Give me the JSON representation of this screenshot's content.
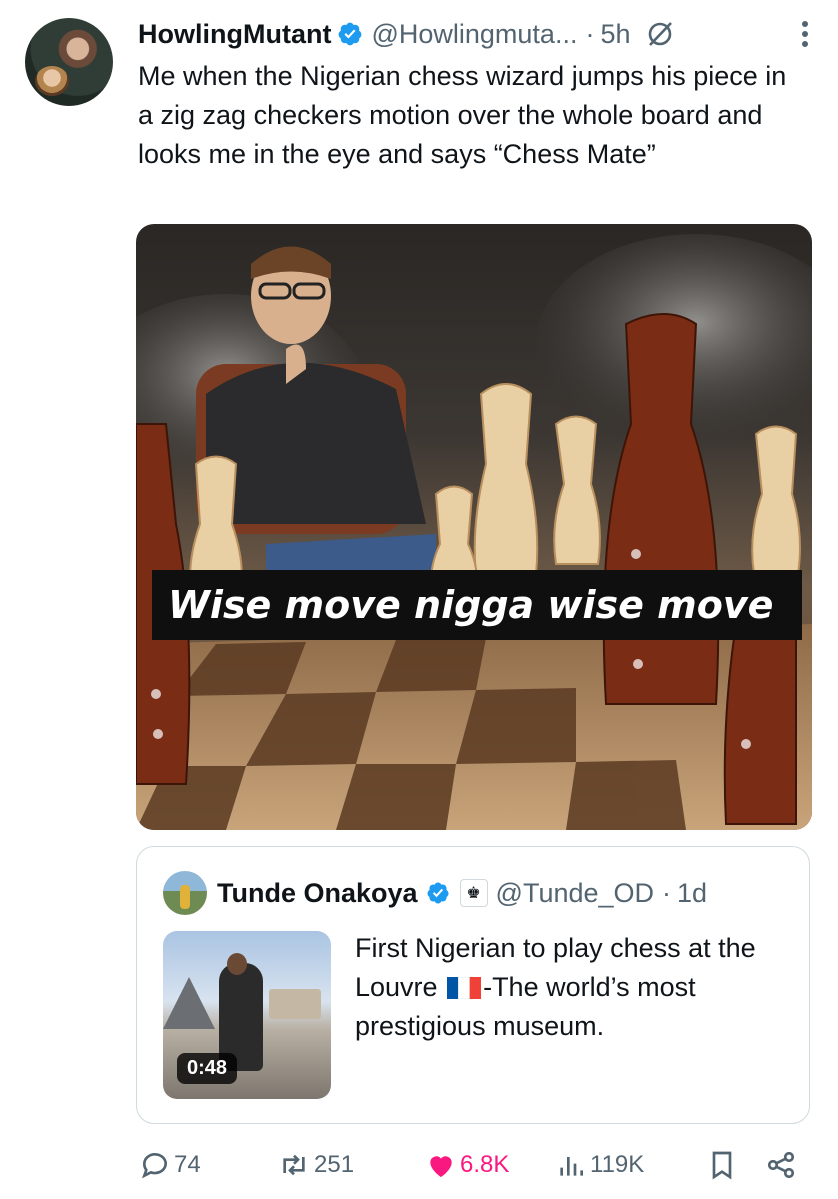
{
  "post": {
    "author_name": "HowlingMutant",
    "handle": "@Howlingmuta...",
    "separator": "·",
    "time": "5h",
    "text": "Me when the Nigerian chess wizard jumps his piece in a zig zag checkers motion over the whole board and looks me in the eye and says “Chess Mate”",
    "media_caption": "Wise move nigga wise move",
    "icons": [
      "verified-badge-icon",
      "grok-icon",
      "more-icon"
    ]
  },
  "quoted": {
    "author_name": "Tunde Onakoya",
    "handle": "@Tunde_OD",
    "separator": "·",
    "time": "1d",
    "text_part1": "First Nigerian to play chess at the Louvre",
    "text_part2": "-The world’s most prestigious museum.",
    "duration": "0:48",
    "flag": "france-flag"
  },
  "actions": {
    "replies": "74",
    "reposts": "251",
    "likes": "6.8K",
    "views": "119K"
  },
  "colors": {
    "verified": "#1d9bf0",
    "like": "#f91880",
    "muted": "#536471",
    "border": "#cfd9de"
  }
}
